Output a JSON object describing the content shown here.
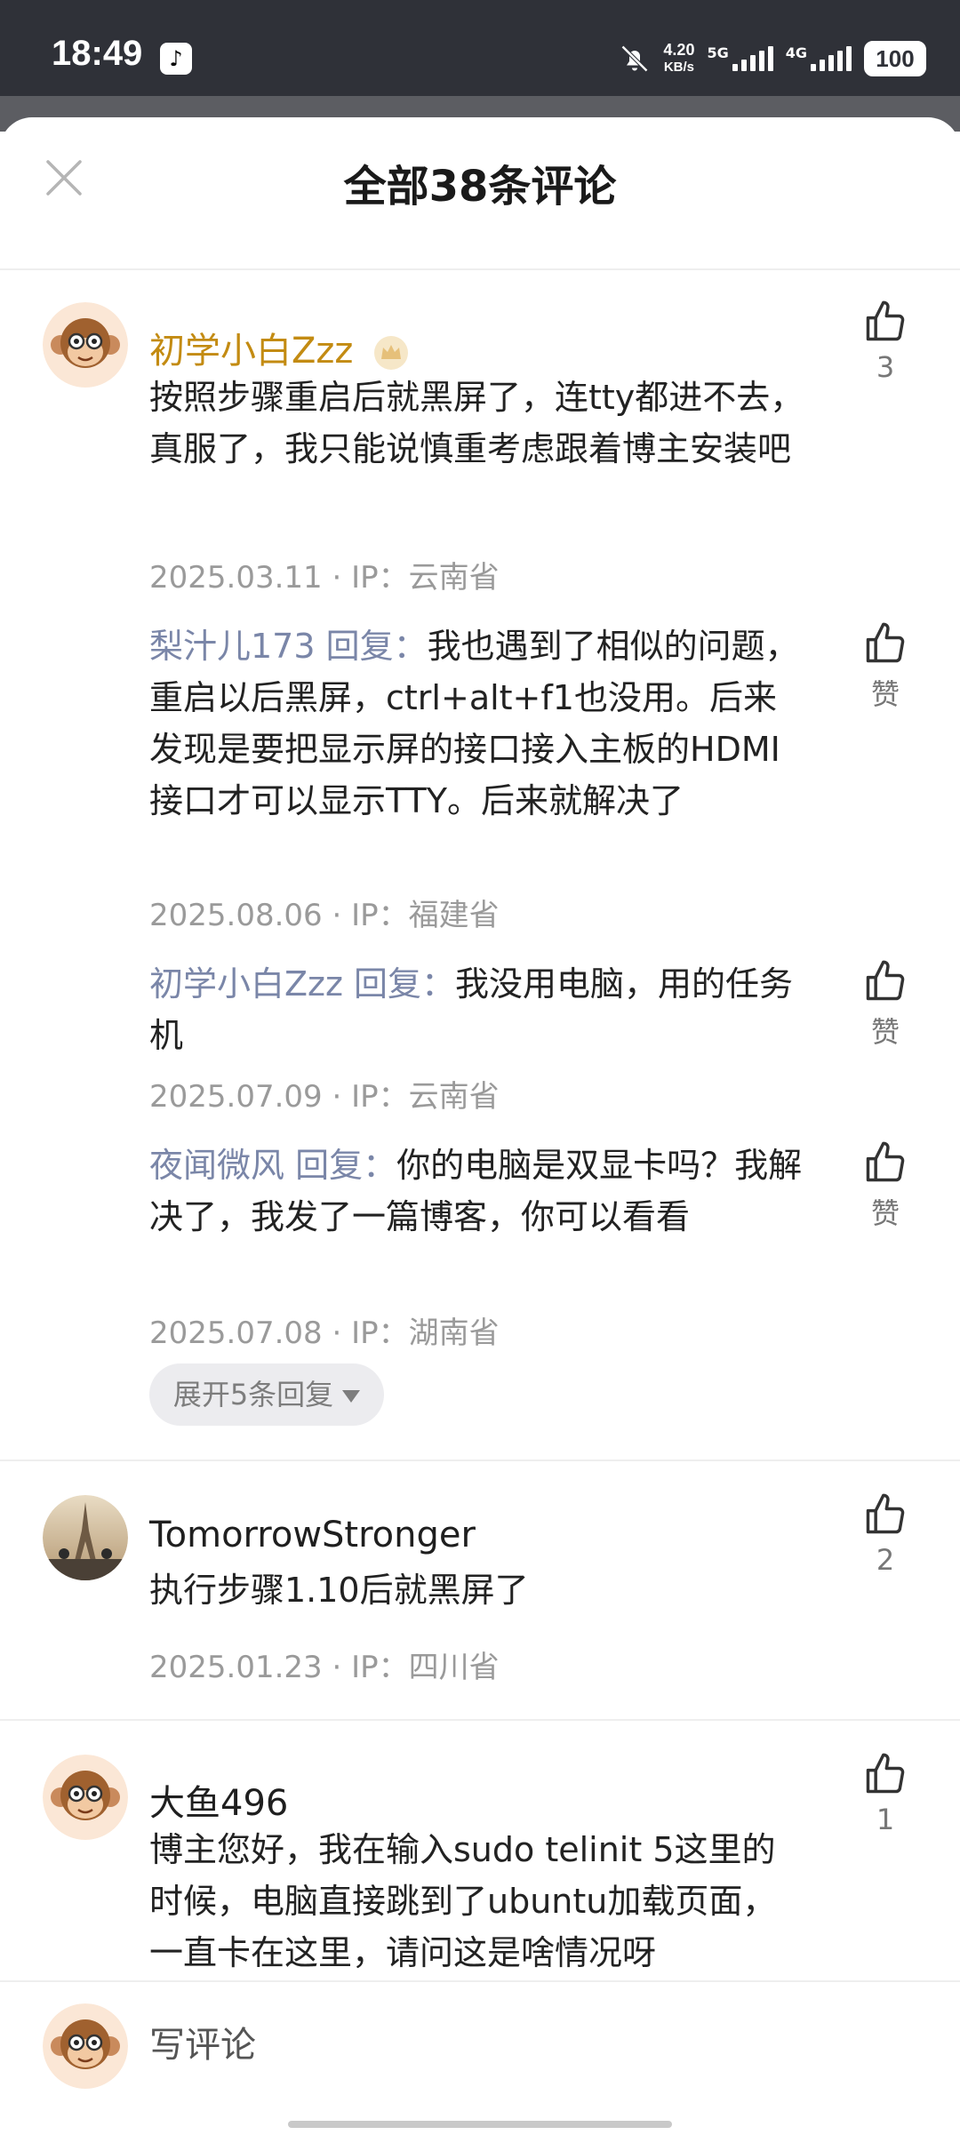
{
  "status_bar": {
    "time": "18:49",
    "app_icon": "tiktok-icon",
    "net_speed_value": "4.20",
    "net_speed_unit": "KB/s",
    "network_a": "5G",
    "network_b": "4G",
    "battery": "100"
  },
  "header": {
    "title": "全部38条评论",
    "close_icon": "close-icon"
  },
  "comments": [
    {
      "username": "初学小白Zzz",
      "text": "按照步骤重启后就黑屏了，连tty都进不去，真服了，我只能说慎重考虑跟着博主安装吧",
      "meta": "2025.03.11 · IP：云南省",
      "likes": "3",
      "replies": [
        {
          "name": "梨汁儿173 回复：",
          "text": "我也遇到了相似的问题，重启以后黑屏，ctrl+alt+f1也没用。后来发现是要把显示屏的接口接入主板的HDMI接口才可以显示TTY。后来就解决了",
          "meta": "2025.08.06 · IP：福建省",
          "likes": "赞"
        },
        {
          "name": "初学小白Zzz 回复：",
          "text": "我没用电脑，用的任务机",
          "meta": "2025.07.09 · IP：云南省",
          "likes": "赞"
        },
        {
          "name": "夜闻微风 回复：",
          "text": "你的电脑是双显卡吗？我解决了，我发了一篇博客，你可以看看",
          "meta": "2025.07.08 · IP：湖南省",
          "likes": "赞"
        }
      ],
      "expand_label": "展开5条回复"
    },
    {
      "username": "TomorrowStronger",
      "text": "执行步骤1.10后就黑屏了",
      "meta": "2025.01.23 · IP：四川省",
      "likes": "2"
    },
    {
      "username": "大鱼496",
      "text": "博主您好，我在输入sudo telinit 5这里的时候，电脑直接跳到了ubuntu加载页面，一直卡在这里，请问这是啥情况呀",
      "likes": "1"
    }
  ],
  "compose": {
    "placeholder": "写评论"
  }
}
